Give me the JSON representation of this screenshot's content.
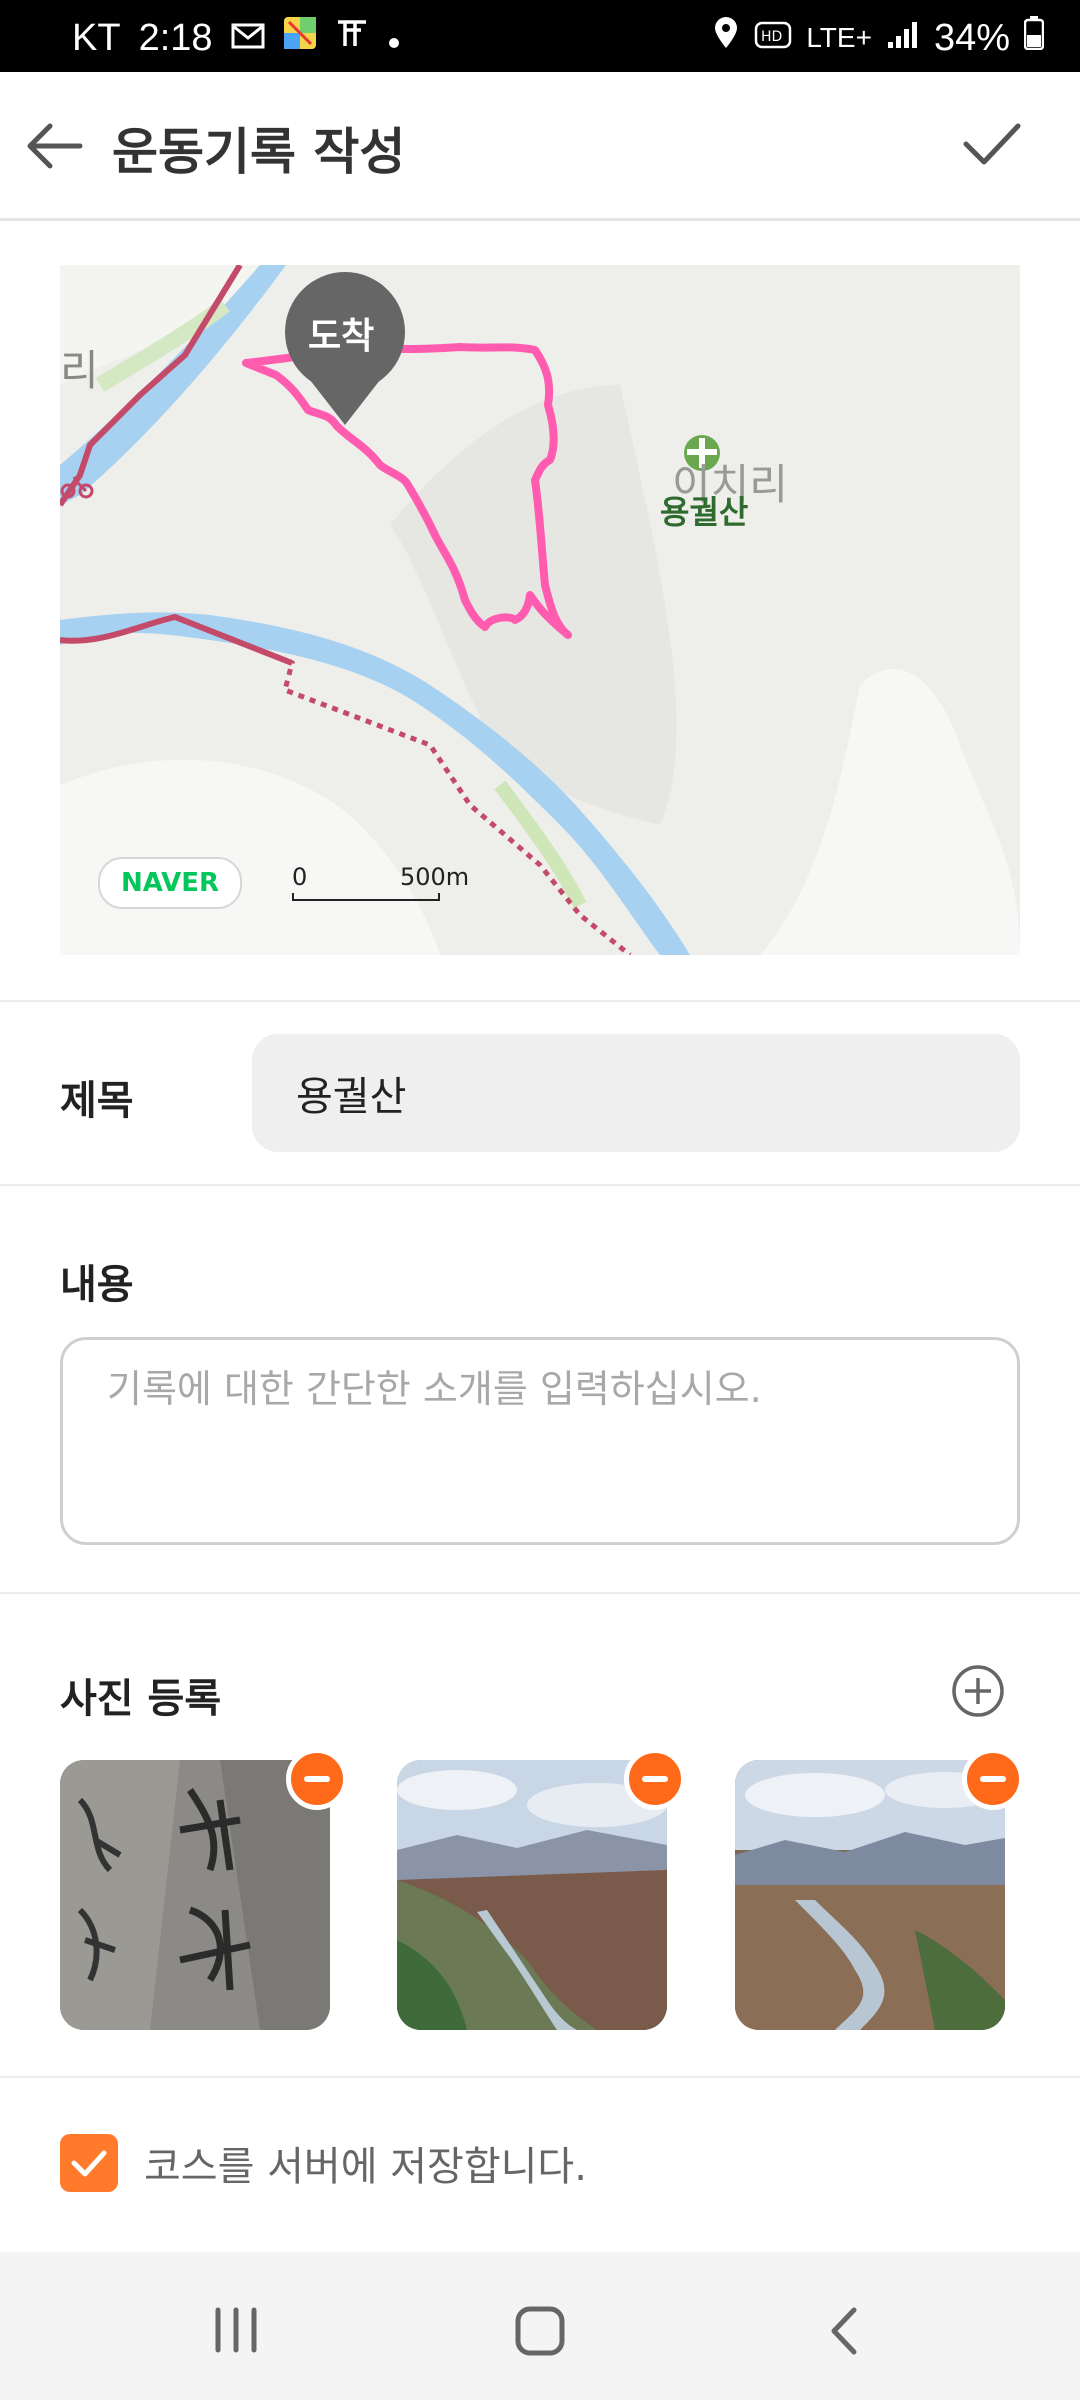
{
  "status_bar": {
    "carrier": "KT",
    "time": "2:18",
    "network": "LTE+",
    "battery": "34%"
  },
  "appbar": {
    "title": "운동기록 작성"
  },
  "map": {
    "arrival_label": "도착",
    "village_label": "이치리",
    "village_label_left": "리",
    "mountain_label": "용궐산",
    "provider_logo": "NAVER",
    "scale_zero": "0",
    "scale_distance": "500m",
    "route_color": "#ff5cb0"
  },
  "form": {
    "title_label": "제목",
    "title_value": "용궐산",
    "content_label": "내용",
    "content_placeholder": "기록에 대한 간단한 소개를 입력하십시오.",
    "photos_label": "사진 등록",
    "save_course_label": "코스를 서버에 저장합니다.",
    "save_course_checked": true
  },
  "colors": {
    "accent": "#ff7a2a",
    "route": "#ff5cb0"
  }
}
